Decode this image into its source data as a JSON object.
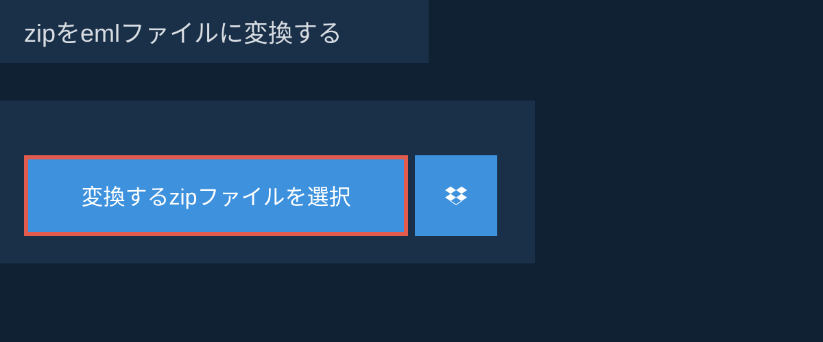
{
  "title": "zipをemlファイルに変換する",
  "buttons": {
    "select_file": "変換するzipファイルを選択"
  }
}
